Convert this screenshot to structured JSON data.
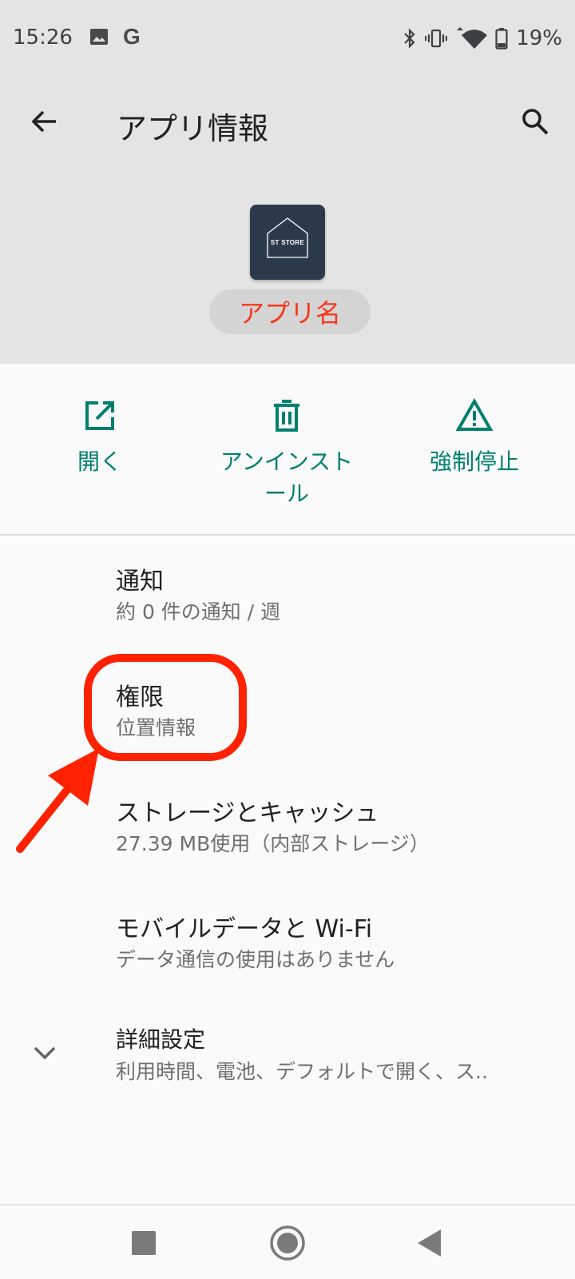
{
  "status": {
    "time": "15:26",
    "battery": "19%",
    "icons": [
      "image-icon",
      "google-icon",
      "bluetooth-icon",
      "vibrate-icon",
      "wifi-icon",
      "battery-icon"
    ],
    "g_letter": "G"
  },
  "app_bar": {
    "title": "アプリ情報",
    "back_icon": "back-arrow-icon",
    "search_icon": "search-icon"
  },
  "app": {
    "icon_text": "ST STORE",
    "name": "アプリ名"
  },
  "actions": [
    {
      "label": "開く",
      "icon": "open-external-icon"
    },
    {
      "label": "アンインストール",
      "icon": "trash-icon"
    },
    {
      "label": "強制停止",
      "icon": "warning-icon"
    }
  ],
  "settings": [
    {
      "title": "通知",
      "subtitle": "約 0 件の通知 / 週"
    },
    {
      "title": "権限",
      "subtitle": "位置情報"
    },
    {
      "title": "ストレージとキャッシュ",
      "subtitle": "27.39 MB使用（内部ストレージ）"
    },
    {
      "title": "モバイルデータと Wi-Fi",
      "subtitle": "データ通信の使用はありません"
    },
    {
      "title": "詳細設定",
      "subtitle": "利用時間、電池、デフォルトで開く、ス.."
    }
  ],
  "nav": [
    "recents-square-icon",
    "home-circle-icon",
    "back-triangle-icon"
  ],
  "colors": {
    "accent": "#00806e",
    "header_bg": "#e4e4e4",
    "body_bg": "#fafafa",
    "annotation": "#ff2200",
    "app_name_red": "#f5371c"
  }
}
